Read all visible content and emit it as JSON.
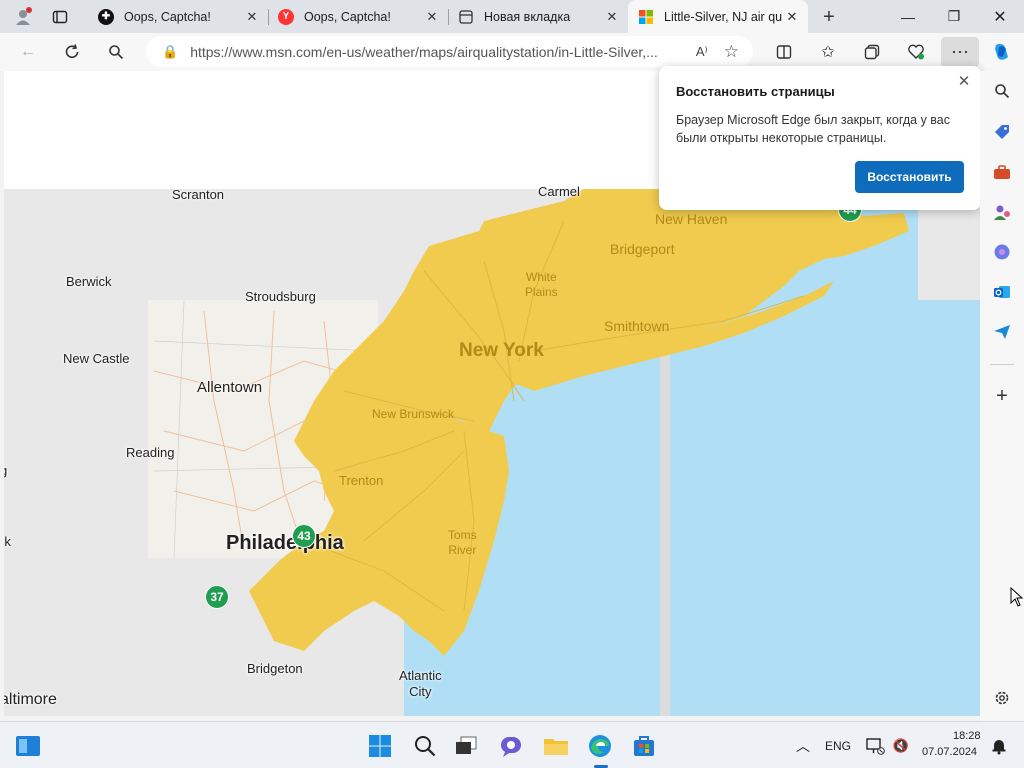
{
  "tabs": [
    {
      "title": "",
      "icon": "profile-icon"
    },
    {
      "title": "Oops, Captcha!",
      "icon": "captcha-icon"
    },
    {
      "title": "Oops, Captcha!",
      "icon": "yandex-icon"
    },
    {
      "title": "Новая вкладка",
      "icon": "newtab-icon"
    },
    {
      "title": "Little-Silver, NJ air qu",
      "icon": "msn-icon",
      "active": true
    }
  ],
  "address": {
    "url": "https://www.msn.com/en-us/weather/maps/airqualitystation/in-Little-Silver,..."
  },
  "popup": {
    "title": "Восстановить страницы",
    "body": "Браузер Microsoft Edge был закрыт, когда у вас были открыты некоторые страницы.",
    "button": "Восстановить"
  },
  "map": {
    "labels": {
      "scranton": "Scranton",
      "carmel": "Carmel",
      "new_haven": "New Haven",
      "bridgeport": "Bridgeport",
      "berwick": "Berwick",
      "stroudsburg": "Stroudsburg",
      "white_plains": "White\nPlains",
      "smithtown": "Smithtown",
      "new_castle": "New Castle",
      "new_york": "New York",
      "allentown": "Allentown",
      "new_brunswick": "New Brunswick",
      "reading": "Reading",
      "trenton": "Trenton",
      "toms_river": "Toms\nRiver",
      "philadelphia": "Philadelphia",
      "rk": "rk",
      "g": "g",
      "bridgeton": "Bridgeton",
      "atlantic_city": "Atlantic\nCity",
      "baltimore": "altimore"
    },
    "aqi": {
      "philadelphia": "43",
      "south": "37",
      "new_haven": "44"
    },
    "colors": {
      "water": "#b0dff5",
      "land": "#e8e8e8",
      "aqi_zone": "#f0cb4e",
      "aqi_badge": "#1e9e4e"
    }
  },
  "taskbar": {
    "lang": "ENG",
    "time": "18:28",
    "date": "07.07.2024"
  }
}
